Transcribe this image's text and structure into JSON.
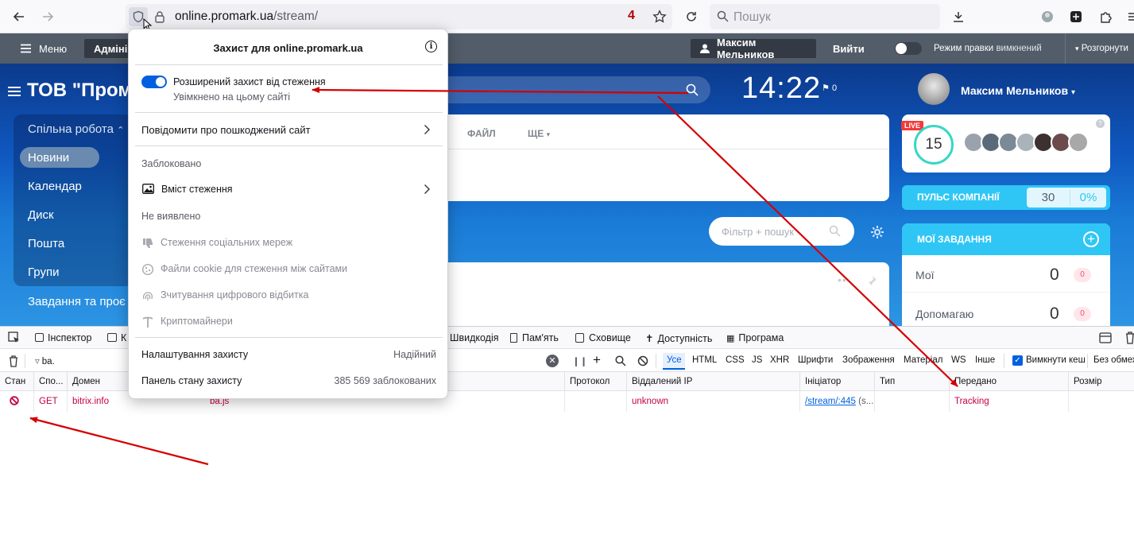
{
  "browser": {
    "url_host": "online.promark.ua",
    "url_path": "/stream/",
    "badge": "4",
    "search_placeholder": "Пошук"
  },
  "bitrix_header": {
    "menu": "Меню",
    "admin_tab": "Адміні",
    "user_button": "Максим Мельников",
    "logout": "Вийти",
    "edit_mode_label": "Режим правки",
    "edit_mode_state": "вимкнений",
    "expand": "Розгорнути"
  },
  "portal": {
    "company": "ТОВ \"Пром",
    "clock": "14:22",
    "flag_count": "0",
    "nav": [
      "Спільна робота",
      "Новини",
      "Календар",
      "Диск",
      "Пошта",
      "Групи",
      "Завдання та проє"
    ],
    "feed_tabs": [
      "ФАЙЛ",
      "ЩЕ"
    ],
    "filter_placeholder": "Фільтр + пошук",
    "profile_name": "Максим Мельников",
    "live_badge": "LIVE",
    "online_count": "15",
    "pulse_label": "ПУЛЬС КОМПАНІЇ",
    "pulse_value": "30",
    "pulse_percent": "0%",
    "tasks_title": "МОЇ ЗАВДАННЯ",
    "tasks": [
      {
        "label": "Мої",
        "count": "0",
        "badge": "0"
      },
      {
        "label": "Допомагаю",
        "count": "0",
        "badge": "0"
      }
    ]
  },
  "popup": {
    "title": "Захист для online.promark.ua",
    "etp_title": "Розширений захист від стеження",
    "etp_sub": "Увімкнено на цьому сайті",
    "report": "Повідомити про пошкоджений сайт",
    "blocked_heading": "Заблоковано",
    "tracking_content": "Вміст стеження",
    "not_found_heading": "Не виявлено",
    "not_found_items": [
      "Стеження соціальних мереж",
      "Файли cookie для стеження між сайтами",
      "Зчитування цифрового відбитка",
      "Криптомайнери"
    ],
    "settings_label": "Налаштування захисту",
    "settings_value": "Надійний",
    "dashboard_label": "Панель стану захисту",
    "dashboard_value": "385 569 заблокованих"
  },
  "devtools": {
    "tabs": [
      "Інспектор",
      "К",
      "Швидкодія",
      "Пам'ять",
      "Сховище",
      "Доступність",
      "Програма"
    ],
    "filter_value": "ba.",
    "types": [
      "Усе",
      "HTML",
      "CSS",
      "JS",
      "XHR",
      "Шрифти",
      "Зображення",
      "Матеріал",
      "WS",
      "Інше"
    ],
    "disable_cache": "Вимкнути кеш",
    "throttle": "Без обмеж",
    "columns": [
      "Стан",
      "Спо...",
      "Домен",
      "Протокол",
      "Віддалений IP",
      "Ініціатор",
      "Тип",
      "Передано",
      "Розмір"
    ],
    "row": {
      "method": "GET",
      "domain": "bitrix.info",
      "file": "ba.js",
      "remote_ip": "unknown",
      "initiator": "/stream/:445",
      "initiator_suffix": "(s...",
      "transferred": "Tracking"
    }
  },
  "colors": {
    "accent": "#0060df",
    "bitrix_header": "#535c69",
    "blocked_red": "#c50042",
    "arrow": "#d40000"
  }
}
